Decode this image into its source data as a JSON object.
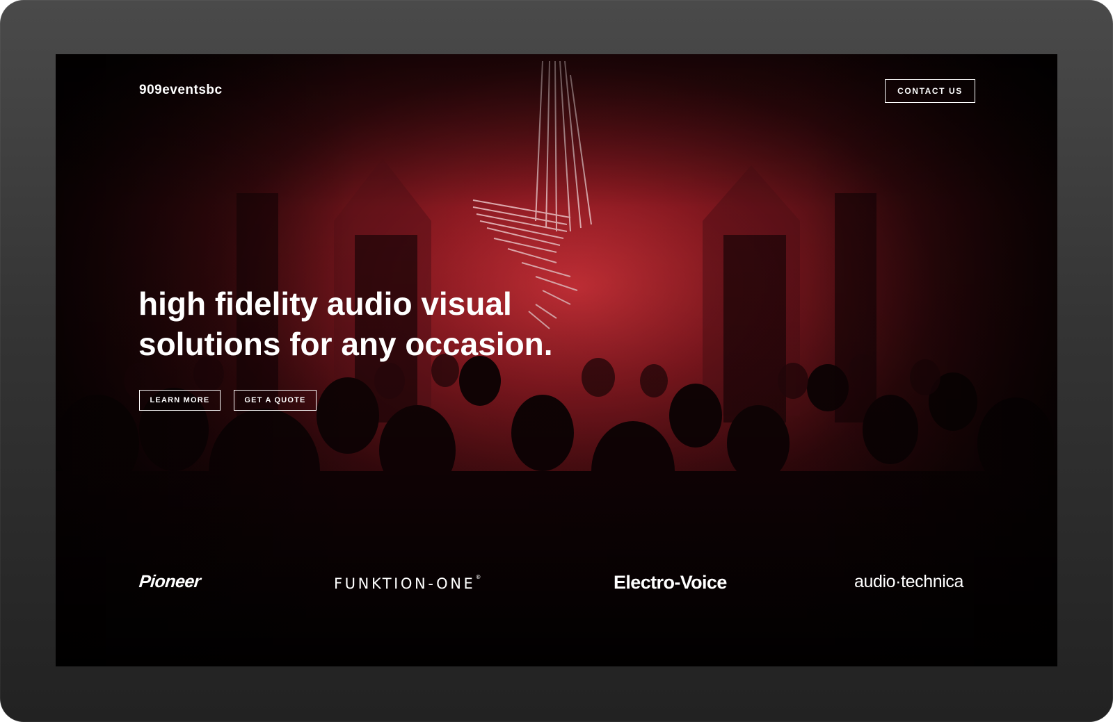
{
  "header": {
    "logo_text": "909eventsbc",
    "contact_label": "CONTACT US"
  },
  "hero": {
    "headline_line1": "high fidelity audio visual",
    "headline_line2": "solutions for any occasion.",
    "learn_more_label": "LEARN MORE",
    "get_quote_label": "GET A QUOTE",
    "background_image": "concert-crowd-red-light"
  },
  "partners": {
    "items": [
      {
        "name": "Pioneer"
      },
      {
        "name": "FUNKTION-ONE",
        "mark": "®"
      },
      {
        "name": "Electro-Voice"
      },
      {
        "name": "audio·technica"
      }
    ]
  },
  "colors": {
    "accent": "#c42a33",
    "text": "#ffffff",
    "device_frame": "#3a3a3a"
  }
}
